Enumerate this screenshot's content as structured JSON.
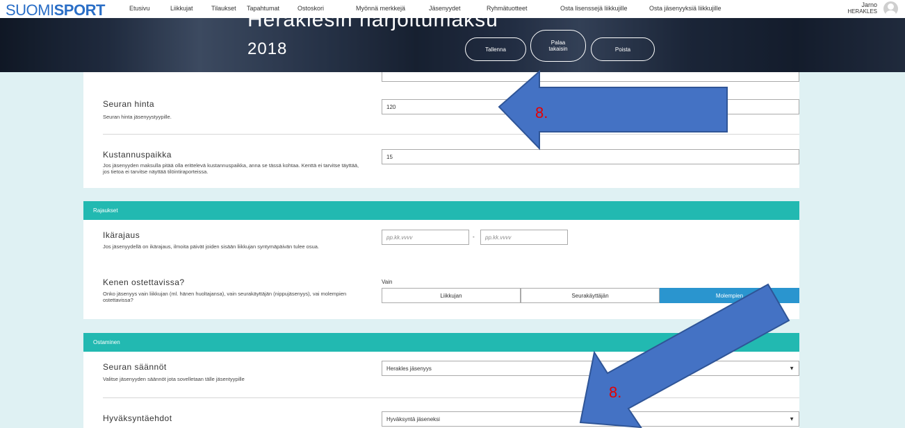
{
  "nav": {
    "logo_thin": "SUOMI",
    "logo_bold": "SPORT",
    "links": [
      "Etusivu",
      "Liikkujat",
      "Tilaukset",
      "Tapahtumat",
      "Ostoskori",
      "Myönnä merkkejä",
      "Jäsenyydet",
      "Ryhmätuotteet",
      "Osta lisenssejä liikkujille",
      "Osta jäsenyyksiä liikkujille"
    ],
    "user_name": "Jarno",
    "user_org": "HERAKLES"
  },
  "hero": {
    "title_line1": "Herakiesin harjoitumaksu",
    "title_line2": "2018",
    "save": "Tallenna",
    "back_line1": "Palaa",
    "back_line2": "takaisin",
    "delete": "Poista"
  },
  "pricing": {
    "club_price_label": "Seuran hinta",
    "club_price_desc": "Seuran hinta jäsenyystyypille.",
    "club_price_value": "120",
    "cost_center_label": "Kustannuspaikka",
    "cost_center_desc": "Jos jäsenyyden maksulla pitää olla erittelevä kustannuspaikka, anna se tässä kohtaa. Kenttä ei tarvitse täyttää, jos tietoa ei tarvitse näyttää tilöintiraporteissa.",
    "cost_center_value": "15"
  },
  "restrictions": {
    "header": "Rajaukset",
    "age_label": "Ikärajaus",
    "age_desc": "Jos jäsenyydellä on ikärajaus, ilmoita päivät joiden sisään liikkujan syntymäpäivän tulee osua.",
    "date_placeholder_from": "pp.kk.vvvv",
    "date_placeholder_to": "pp.kk.vvvv",
    "date_separator": "-",
    "buyer_label": "Kenen ostettavissa?",
    "buyer_desc": "Onko jäsenyys vain liikkujan (ml. hänen huoltajansa), vain seurakäyttäjän (nippujäsenyys), vai molempien ostettavissa?",
    "buyer_small": "Vain",
    "options": [
      "Liikkujan",
      "Seurakäyttäjän",
      "Molempien"
    ],
    "selected": "Molempien"
  },
  "purchasing": {
    "header": "Ostaminen",
    "rules_label": "Seuran säännöt",
    "rules_desc": "Valitse jäsenyyden säännöt jota sovelletaan tälle jäsentyypille",
    "rules_value": "Herakles jäsenyys",
    "approval_label": "Hyväksyntäehdot",
    "approval_value": "Hyväksyntä jäseneksi"
  },
  "annotations": {
    "number1": "8.",
    "number2": "8."
  },
  "colors": {
    "teal": "#22b9b1",
    "selected_blue": "#2a95cf",
    "arrow_fill": "#4472c4",
    "arrow_stroke": "#2f5597",
    "annotation_red": "#e60000",
    "brand_blue": "#2a6ec6"
  }
}
